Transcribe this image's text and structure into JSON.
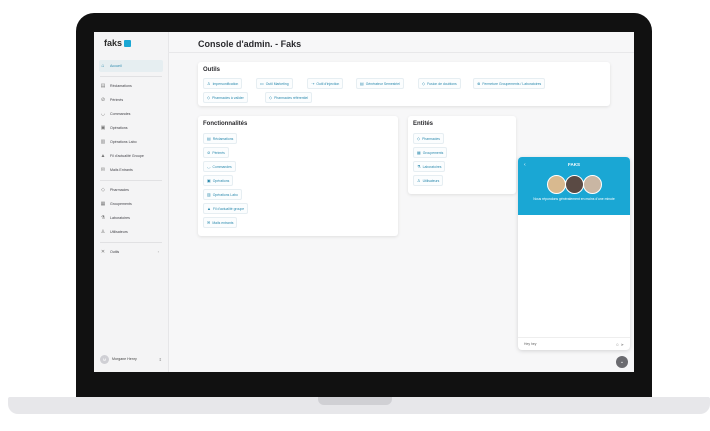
{
  "brand": {
    "name": "faks"
  },
  "page": {
    "title": "Console d'admin. - Faks"
  },
  "sidebar": {
    "items": [
      {
        "label": "Accueil",
        "icon": "home-icon",
        "active": true
      },
      {
        "label": "Réclamations",
        "icon": "document-icon"
      },
      {
        "label": "Périmés",
        "icon": "expired-icon"
      },
      {
        "label": "Commandes",
        "icon": "cart-icon"
      },
      {
        "label": "Opérations",
        "icon": "operations-icon"
      },
      {
        "label": "Opérations Labo",
        "icon": "lab-operations-icon"
      },
      {
        "label": "Fil d'actualité Groupe",
        "icon": "thumb-icon"
      },
      {
        "label": "Mails Entrants",
        "icon": "mail-icon"
      },
      {
        "label": "Pharmacies",
        "icon": "pharmacy-icon"
      },
      {
        "label": "Groupements",
        "icon": "group-icon"
      },
      {
        "label": "Laboratoires",
        "icon": "flask-icon"
      },
      {
        "label": "Utilisateurs",
        "icon": "user-icon"
      },
      {
        "label": "Outils",
        "icon": "tools-icon"
      }
    ],
    "user": {
      "initial": "M",
      "name": "Morgane Henry"
    }
  },
  "outils": {
    "title": "Outils",
    "chips": [
      "Impersonification",
      "Outil Marketing",
      "Outil d'injection",
      "Générateur Semestriel",
      "Fusion de doublons",
      "Fermeture Groupements / Laboratoires",
      "Pharmacies à valider",
      "Pharmacies référentiel"
    ]
  },
  "fonctionnalites": {
    "title": "Fonctionnalités",
    "chips": [
      "Réclamations",
      "Périmés",
      "Commandes",
      "Opérations",
      "Opérations Labo",
      "Fil d'actualité groupe",
      "Mails entrants"
    ]
  },
  "entites": {
    "title": "Entités",
    "chips": [
      "Pharmacies",
      "Groupements",
      "Laboratoires",
      "Utilisateurs"
    ]
  },
  "chat": {
    "title": "FAKS",
    "message": "Nous répondons généralement en moins d'une minute",
    "input_placeholder": "Hey hey",
    "accent": "#1aa7d4"
  }
}
